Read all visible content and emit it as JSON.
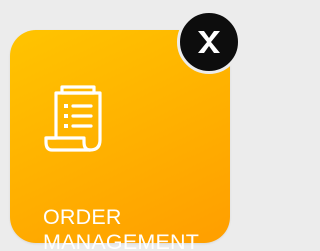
{
  "tile": {
    "label_line1": "ORDER",
    "label_line2": "MANAGEMENT",
    "icon": "order-document-icon",
    "background_color": "#ffb300",
    "text_color": "#ffffff"
  },
  "badge": {
    "icon": "close-icon",
    "background_color": "#0d0d0d",
    "icon_color": "#ffffff"
  }
}
